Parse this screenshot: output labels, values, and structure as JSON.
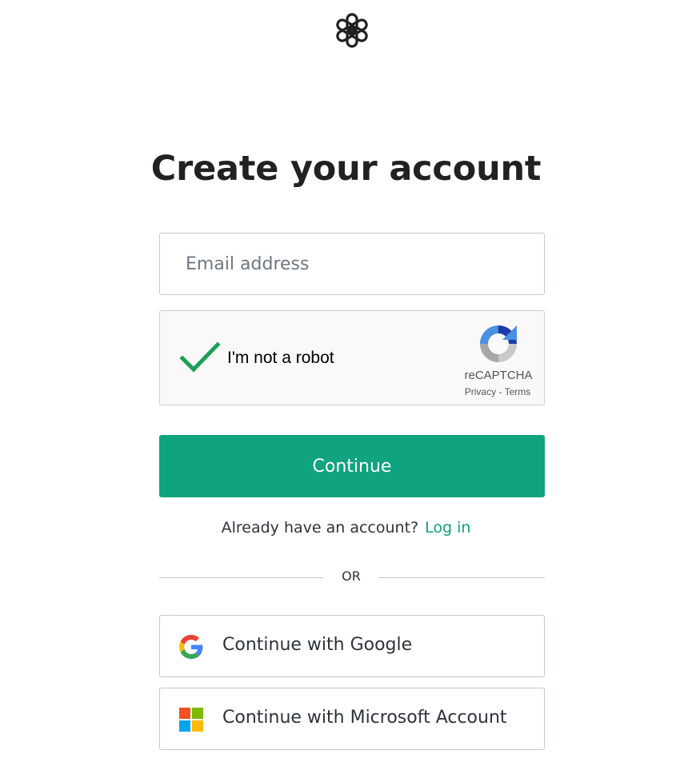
{
  "header": {
    "logo_icon": "openai-logo-icon"
  },
  "main": {
    "title": "Create your account",
    "email": {
      "placeholder": "Email address",
      "value": ""
    },
    "captcha": {
      "checked": true,
      "label": "I'm not a robot",
      "brand": "reCAPTCHA",
      "privacy": "Privacy",
      "separator": "-",
      "terms": "Terms",
      "check_icon": "checkmark-icon",
      "logo_icon": "recaptcha-logo-icon"
    },
    "continue_label": "Continue",
    "login_prompt": "Already have an account?",
    "login_link": "Log in",
    "divider_text": "OR",
    "social": [
      {
        "label": "Continue with Google",
        "icon": "google-icon"
      },
      {
        "label": "Continue with Microsoft Account",
        "icon": "microsoft-icon"
      }
    ]
  },
  "colors": {
    "accent": "#10a37f",
    "text": "#2d333a",
    "border": "#c2c8d0",
    "captcha_check": "#1b9e57"
  }
}
